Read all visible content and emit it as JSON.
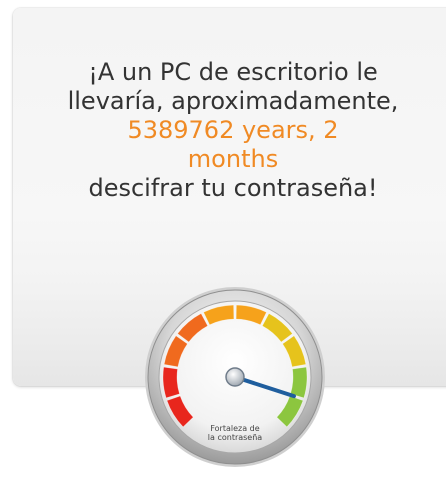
{
  "message": {
    "line_1": "¡A un PC de escritorio le",
    "line_2": "llevaría, aproximadamente,",
    "duration": "5389762 years, 2 months",
    "line_3": "descifrar tu contraseña!"
  },
  "gauge": {
    "label_line_1": "Fortaleza de",
    "label_line_2": "la contraseña",
    "strength_fraction": 0.9,
    "colors": {
      "red": "#e8261d",
      "orange": "#f06a1e",
      "amber": "#f6a21b",
      "yellow": "#e6c31c",
      "green": "#8cc63f",
      "needle": "#1f5e9e"
    }
  }
}
